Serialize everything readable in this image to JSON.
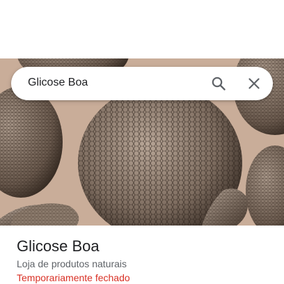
{
  "search": {
    "query": "Glicose Boa"
  },
  "place": {
    "name": "Glicose Boa",
    "category": "Loja de produtos naturais",
    "status": "Temporariamente fechado"
  },
  "icons": {
    "search": "search-icon",
    "close": "close-icon"
  },
  "colors": {
    "status_closed": "#d93025",
    "text_primary": "#202124",
    "text_secondary": "#5f6368",
    "photo_background": "#c8ab97"
  }
}
